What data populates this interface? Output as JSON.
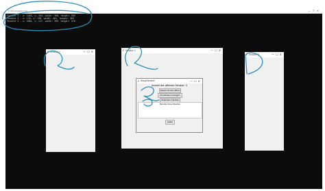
{
  "console": {
    "title": "C:\\Windows\\py.exe",
    "lines": [
      "Fenster 1 - x: 1426, y: 164, width: 398, height: 555",
      "Fenster 2 - x: 170, y: 138, width: 461, height: 583",
      "Fenster 3 - x: 3904, y: 117, width: 399, height: 578"
    ]
  },
  "windows": [
    {
      "title": "Fenster 1"
    },
    {
      "title": "Fenster 2"
    },
    {
      "title": "Fenster 3"
    }
  ],
  "window_controls": {
    "minimize": "—",
    "maximize": "☐",
    "close": "✕"
  },
  "dialog": {
    "title": "Hauptfenster",
    "count_label": "Anzahl der offenen Fenster: 3",
    "buttons": {
      "show_windows": "Neues Fenster öffnen",
      "show_coords": "Koordinaten anzeigen",
      "export_console": "Exportiere Konsole"
    },
    "list_header": "Fenster Koordinaten",
    "close_button": "Laden"
  },
  "annotation_color": "#2d8fb8"
}
